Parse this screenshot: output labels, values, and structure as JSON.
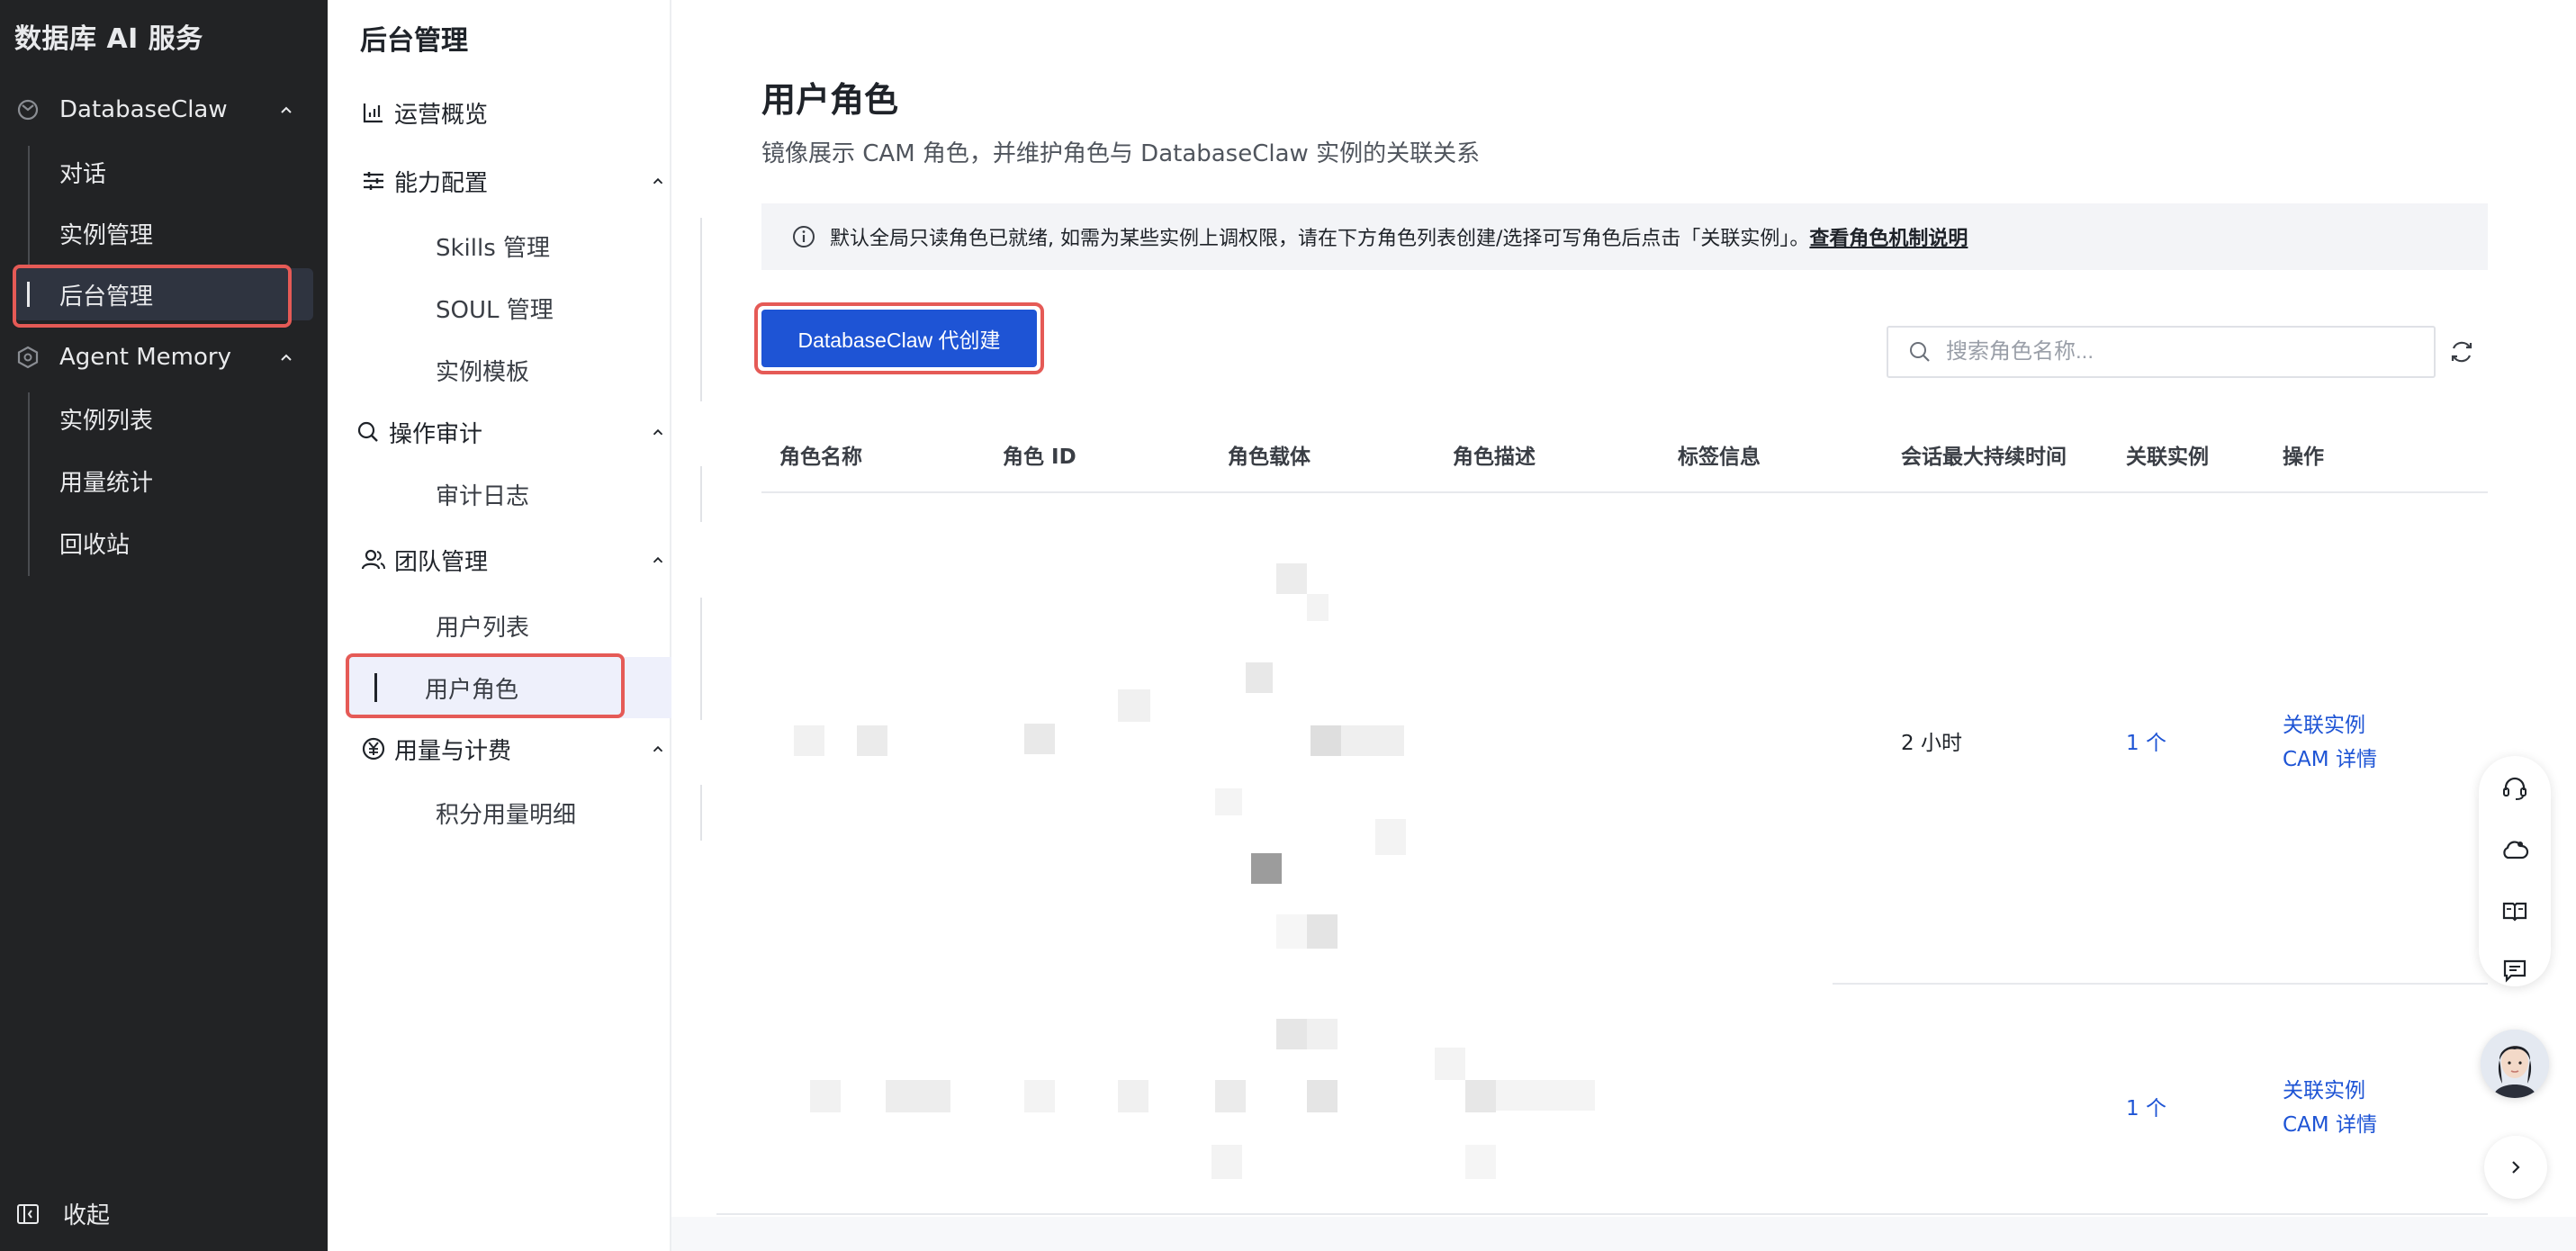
{
  "sidebar": {
    "app_title": "数据库 AI 服务",
    "groups": [
      {
        "label": "DatabaseClaw",
        "items": [
          "对话",
          "实例管理",
          "后台管理"
        ]
      },
      {
        "label": "Agent Memory",
        "items": [
          "实例列表",
          "用量统计",
          "回收站"
        ]
      }
    ],
    "active_item": "后台管理",
    "collapse_label": "收起"
  },
  "subnav": {
    "title": "后台管理",
    "overview": "运营概览",
    "groups": [
      {
        "label": "能力配置",
        "items": [
          "Skills 管理",
          "SOUL 管理",
          "实例模板"
        ]
      },
      {
        "label": "操作审计",
        "items": [
          "审计日志"
        ]
      },
      {
        "label": "团队管理",
        "items": [
          "用户列表",
          "用户角色"
        ]
      },
      {
        "label": "用量与计费",
        "items": [
          "积分用量明细"
        ]
      }
    ],
    "active_item": "用户角色"
  },
  "main": {
    "title": "用户角色",
    "description": "镜像展示 CAM 角色，并维护角色与 DatabaseClaw 实例的关联关系",
    "notice_text": "默认全局只读角色已就绪, 如需为某些实例上调权限，请在下方角色列表创建/选择可写角色后点击「关联实例」。",
    "notice_link": "查看角色机制说明",
    "create_button": "DatabaseClaw 代创建",
    "search_placeholder": "搜索角色名称...",
    "table": {
      "columns": [
        "角色名称",
        "角色 ID",
        "角色载体",
        "角色描述",
        "标签信息",
        "会话最大持续时间",
        "关联实例",
        "操作"
      ],
      "rows": [
        {
          "duration": "2 小时",
          "linked": "1 个",
          "actions": [
            "关联实例",
            "CAM 详情"
          ]
        },
        {
          "duration": "",
          "linked": "1 个",
          "actions": [
            "关联实例",
            "CAM 详情"
          ]
        }
      ]
    }
  },
  "colors": {
    "accent": "#1e54d5",
    "highlight": "#e55a56",
    "sidebar_bg": "#222325"
  }
}
